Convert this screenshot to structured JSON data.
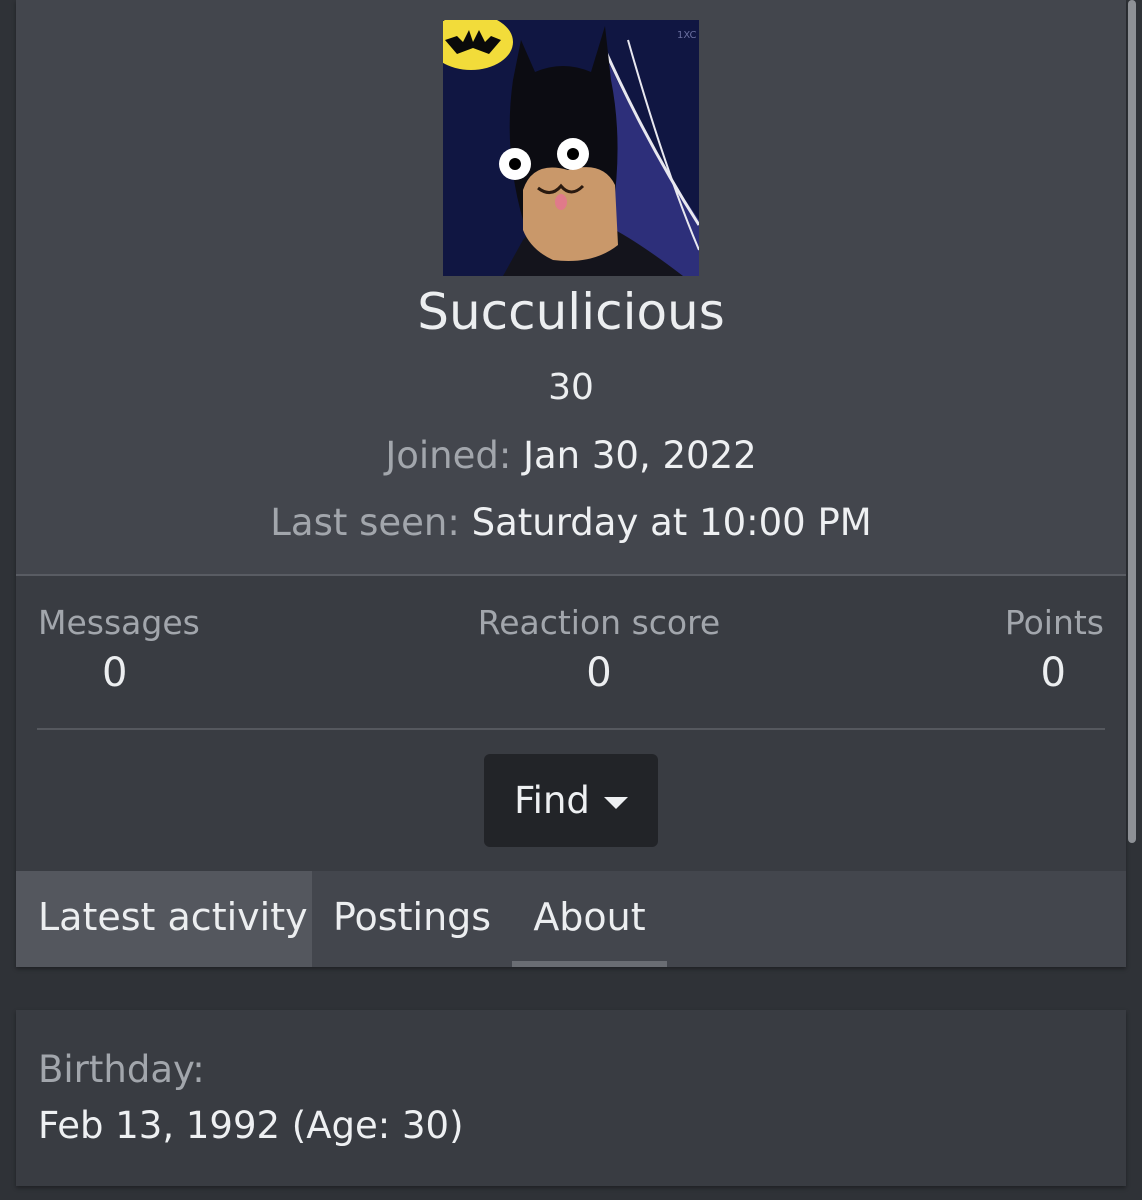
{
  "profile": {
    "avatar_icon": "batman-avatar-icon",
    "username": "Succulicious",
    "user_title": "30",
    "joined_label": "Joined:",
    "joined_value": "Jan 30, 2022",
    "last_seen_label": "Last seen:",
    "last_seen_value": "Saturday at 10:00 PM"
  },
  "stats": {
    "messages_label": "Messages",
    "messages_value": "0",
    "reaction_label": "Reaction score",
    "reaction_value": "0",
    "points_label": "Points",
    "points_value": "0"
  },
  "find_button": {
    "label": "Find",
    "icon": "caret-down-icon"
  },
  "tabs": [
    {
      "label": "Latest activity",
      "state": "hover"
    },
    {
      "label": "Postings",
      "state": "normal"
    },
    {
      "label": "About",
      "state": "selected"
    }
  ],
  "about": {
    "birthday_label": "Birthday:",
    "birthday_value": "Feb 13, 1992 (Age: 30)"
  },
  "colors": {
    "page_bg": "#2f3237",
    "header_bg": "#43464d",
    "card_bg": "#393c42",
    "button_bg": "#222428",
    "text_primary": "#eceef0",
    "text_muted": "#a2a6ac"
  }
}
